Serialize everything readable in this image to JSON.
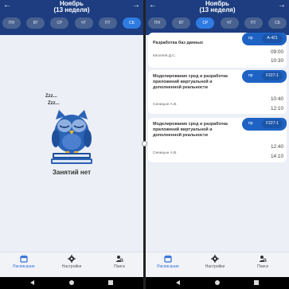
{
  "month": "Ноябрь",
  "week": "(13 неделя)",
  "days": [
    "ПН",
    "ВТ",
    "СР",
    "ЧТ",
    "ПТ",
    "СБ"
  ],
  "empty": {
    "zzz1": "Zzz...",
    "zzz2": "Zzz...",
    "message": "Занятий нет"
  },
  "lessons": [
    {
      "title": "Разработка баз данных",
      "teacher": "Киселев Д.С.",
      "type": "пр",
      "room": "А-421",
      "start": "09:00",
      "end": "10:30"
    },
    {
      "title": "Моделирование сред и разработка приложений виртуальной и дополненной реальности",
      "teacher": "Синицын А.В.",
      "type": "пр",
      "room": "F227-1",
      "start": "10:40",
      "end": "12:10"
    },
    {
      "title": "Моделирование сред и разработка приложений виртуальной и дополненной реальности",
      "teacher": "Синицын А.В.",
      "type": "пр",
      "room": "F227-1",
      "start": "12:40",
      "end": "14:10"
    }
  ],
  "nav": {
    "schedule": "Расписание",
    "settings": "Настройки",
    "search": "Поиск"
  },
  "colors": {
    "header": "#1d3d80",
    "accent": "#2f7be2",
    "badge": "#1e63c4",
    "background": "#eceff5"
  },
  "icons": {
    "prev": "chevron-left-icon",
    "next": "chevron-right-icon",
    "schedule": "calendar-icon",
    "settings": "gear-icon",
    "search": "people-search-icon"
  }
}
